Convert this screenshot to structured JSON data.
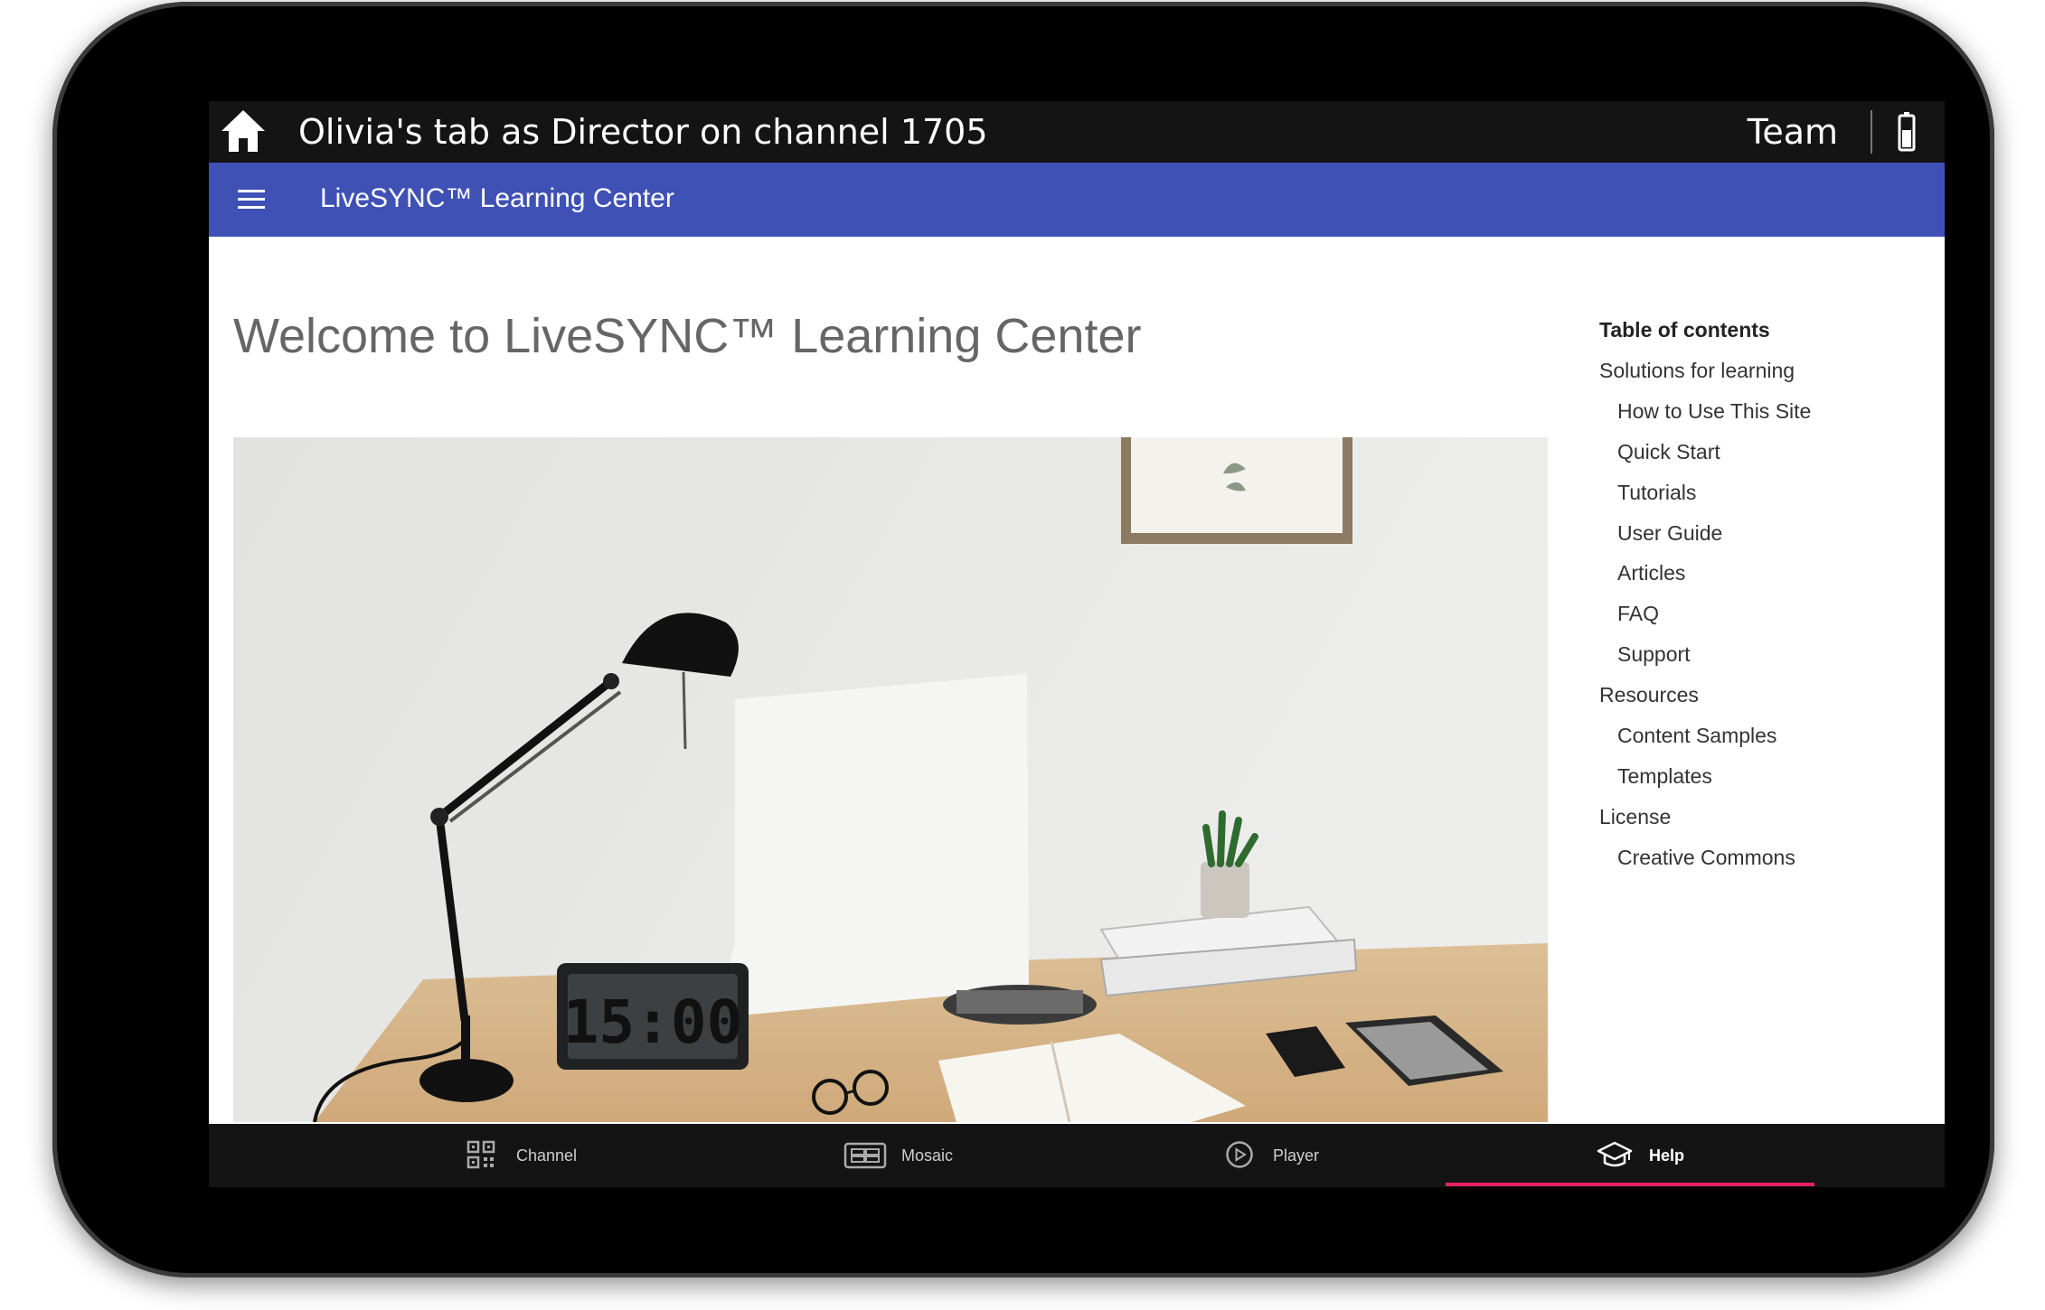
{
  "status_bar": {
    "title": "Olivia's tab as Director on channel 1705",
    "team": "Team"
  },
  "app_bar": {
    "title": "LiveSYNC™ Learning Center"
  },
  "main": {
    "page_title": "Welcome to LiveSYNC™ Learning Center",
    "hero_clock": "15:00"
  },
  "toc": {
    "heading": "Table of contents",
    "items": [
      {
        "label": "Solutions for learning",
        "level": 1
      },
      {
        "label": "How to Use This Site",
        "level": 2
      },
      {
        "label": "Quick Start",
        "level": 2
      },
      {
        "label": "Tutorials",
        "level": 2
      },
      {
        "label": "User Guide",
        "level": 2
      },
      {
        "label": "Articles",
        "level": 2
      },
      {
        "label": "FAQ",
        "level": 2
      },
      {
        "label": "Support",
        "level": 2
      },
      {
        "label": "Resources",
        "level": 1
      },
      {
        "label": "Content Samples",
        "level": 2
      },
      {
        "label": "Templates",
        "level": 2
      },
      {
        "label": "License",
        "level": 1
      },
      {
        "label": "Creative Commons",
        "level": 2
      }
    ]
  },
  "tabs": [
    {
      "label": "Channel",
      "icon": "qr-code-icon",
      "active": false
    },
    {
      "label": "Mosaic",
      "icon": "mosaic-icon",
      "active": false
    },
    {
      "label": "Player",
      "icon": "play-circle-icon",
      "active": false
    },
    {
      "label": "Help",
      "icon": "graduation-cap-icon",
      "active": true
    }
  ],
  "colors": {
    "app_bar": "#3f51b5",
    "status_bar": "#141414",
    "active_tab_indicator": "#e91e63"
  }
}
